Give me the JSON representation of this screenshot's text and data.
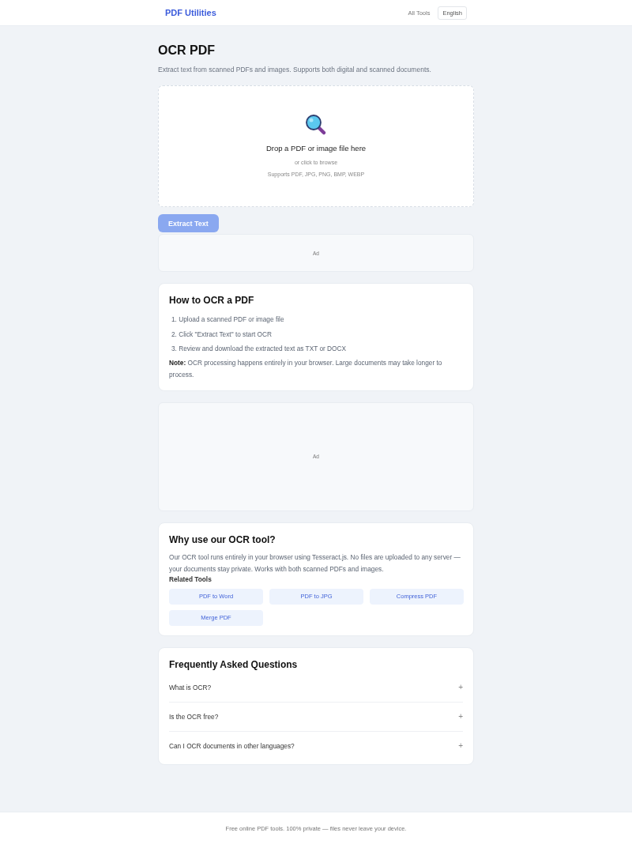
{
  "header": {
    "brand": "PDF Utilities",
    "nav_link": "All Tools",
    "language": "English"
  },
  "page": {
    "title": "OCR PDF",
    "subtitle": "Extract text from scanned PDFs and images. Supports both digital and scanned documents."
  },
  "drop_zone": {
    "prompt": "Drop a PDF or image file here",
    "hint": "or click to browse",
    "formats": "Supports PDF, JPG, PNG, BMP, WEBP"
  },
  "action_button": {
    "label": "Extract Text",
    "disabled": true
  },
  "ads": [
    {
      "label": "Ad",
      "kind": "banner"
    },
    {
      "label": "Ad",
      "kind": "panel"
    }
  ],
  "how_to": {
    "title": "How to OCR a PDF",
    "steps": [
      "1. Upload a scanned PDF or image file",
      "2. Click \"Extract Text\" to start OCR",
      "3. Review and download the extracted text as TXT or DOCX"
    ],
    "note": "**Note:** OCR processing happens entirely in your browser. Large documents may take longer to process."
  },
  "why": {
    "title": "Why use our OCR tool?",
    "text": "Our OCR tool runs entirely in your browser using Tesseract.js. No files are uploaded to any server — your documents stay private. Works with both scanned PDFs and images.",
    "related_title": "Related Tools",
    "related": [
      "PDF to Word",
      "PDF to JPG",
      "Compress PDF",
      "Merge PDF"
    ]
  },
  "faq": {
    "title": "Frequently Asked Questions",
    "items": [
      {
        "question": "What is OCR?",
        "toggle": "+",
        "expanded": false
      },
      {
        "question": "Is the OCR free?",
        "toggle": "+",
        "expanded": false
      },
      {
        "question": "Can I OCR documents in other languages?",
        "toggle": "+",
        "expanded": false
      }
    ]
  },
  "footer": {
    "text": "Free online PDF tools. 100% private — files never leave your device."
  }
}
